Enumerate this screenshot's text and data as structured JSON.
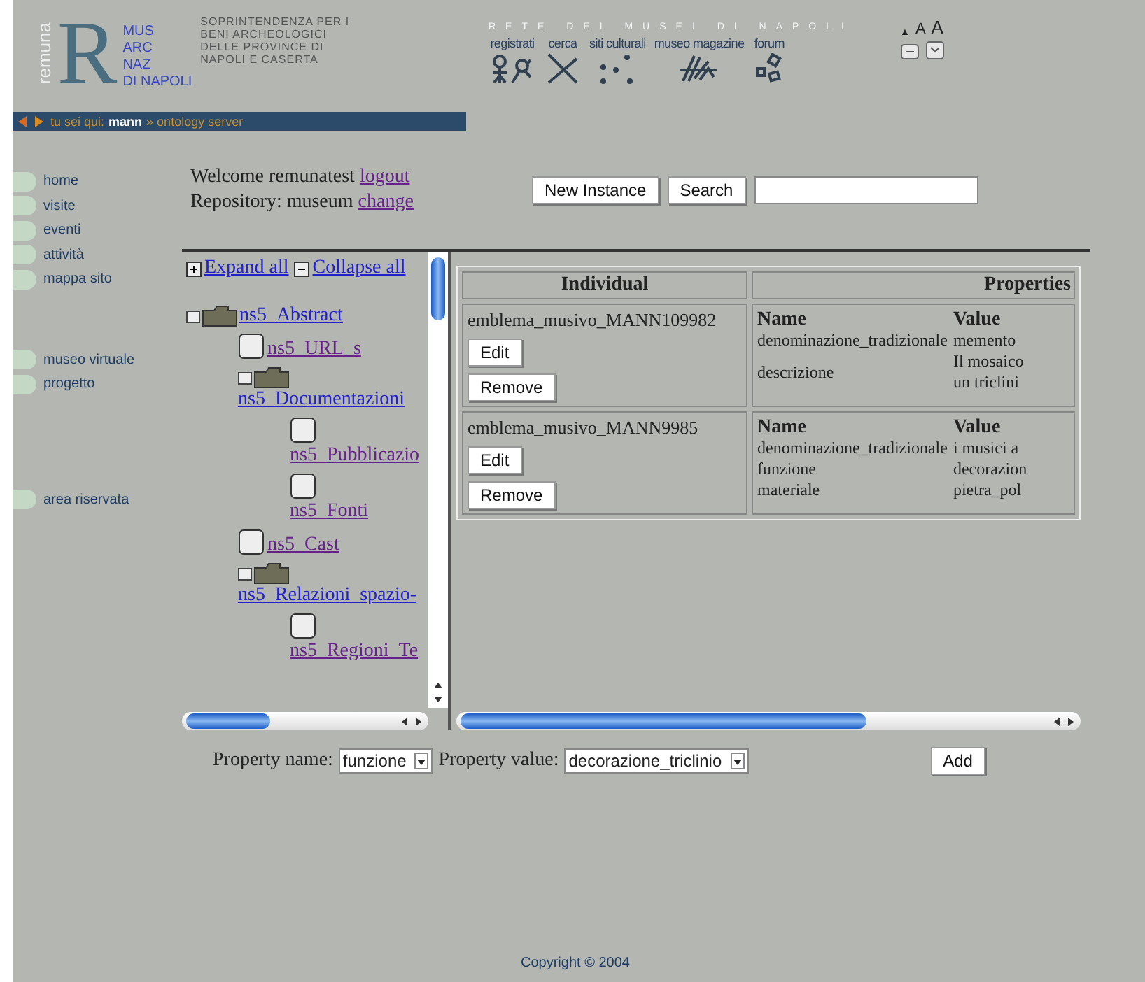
{
  "logo": {
    "vertical": "remuna",
    "letter": "R",
    "museum_lines": [
      "MUS",
      "ARC",
      "NAZ",
      "DI NAPOLI"
    ],
    "agency_lines": [
      "SOPRINTENDENZA PER I",
      "BENI ARCHEOLOGICI",
      "DELLE PROVINCE DI",
      "NAPOLI E CASERTA"
    ]
  },
  "network": {
    "title": "RETE DEI MUSEI DI NAPOLI",
    "links": [
      "registrati",
      "cerca",
      "siti culturali",
      "museo magazine",
      "forum"
    ]
  },
  "font_sizes": [
    "▲",
    "A",
    "A"
  ],
  "breadcrumb": {
    "prefix": "tu sei qui:",
    "current": "mann",
    "rest": "» ontology server"
  },
  "nav_groups": [
    [
      "home",
      "visite",
      "eventi",
      "attività",
      "mappa sito"
    ],
    [
      "museo virtuale",
      "progetto"
    ],
    [
      "area riservata"
    ]
  ],
  "welcome": {
    "text": "Welcome remunatest",
    "logout": "logout",
    "logout_visited": true,
    "repo": "Repository: museum",
    "change": "change",
    "change_visited": true
  },
  "buttons": {
    "new_instance": "New Instance",
    "search": "Search"
  },
  "tree_controls": {
    "expand": "Expand all",
    "collapse": "Collapse all"
  },
  "tree": [
    {
      "label": "ns5_Abstract",
      "kind": "folder",
      "visited": false,
      "children": [
        {
          "label": "ns5_URL_s",
          "kind": "leaf",
          "visited": true
        },
        {
          "label": "ns5_Documentazioni",
          "kind": "folder",
          "visited": false,
          "children": [
            {
              "label": "ns5_Pubblicazio",
              "kind": "leaf",
              "visited": true
            },
            {
              "label": "ns5_Fonti",
              "kind": "leaf",
              "visited": true
            }
          ]
        },
        {
          "label": "ns5_Cast",
          "kind": "leaf",
          "visited": true
        },
        {
          "label": "ns5_Relazioni_spazio-",
          "kind": "folder",
          "visited": false,
          "children": [
            {
              "label": "ns5_Regioni_Te",
              "kind": "leaf",
              "visited": true
            }
          ]
        }
      ]
    }
  ],
  "table": {
    "columns": [
      "Individual",
      "Properties"
    ],
    "rows": [
      {
        "individual": "emblema_musivo_MANN109982",
        "edit": "Edit",
        "remove": "Remove",
        "prop_headers": [
          "Name",
          "Value"
        ],
        "props": [
          {
            "name": "denominazione_tradizionale",
            "value": [
              "memento"
            ]
          },
          {
            "name": "descrizione",
            "value": [
              "Il mosaico",
              "un triclini"
            ]
          }
        ]
      },
      {
        "individual": "emblema_musivo_MANN9985",
        "edit": "Edit",
        "remove": "Remove",
        "prop_headers": [
          "Name",
          "Value"
        ],
        "props": [
          {
            "name": "denominazione_tradizionale",
            "value": [
              "i musici a"
            ]
          },
          {
            "name": "funzione",
            "value": [
              "decorazion"
            ]
          },
          {
            "name": "materiale",
            "value": [
              "pietra_pol"
            ]
          }
        ]
      }
    ]
  },
  "form": {
    "name_label": "Property name:",
    "name_value": "funzione",
    "value_label": "Property value:",
    "value_value": "decorazione_triclinio",
    "add": "Add"
  },
  "footer": "Copyright © 2004"
}
